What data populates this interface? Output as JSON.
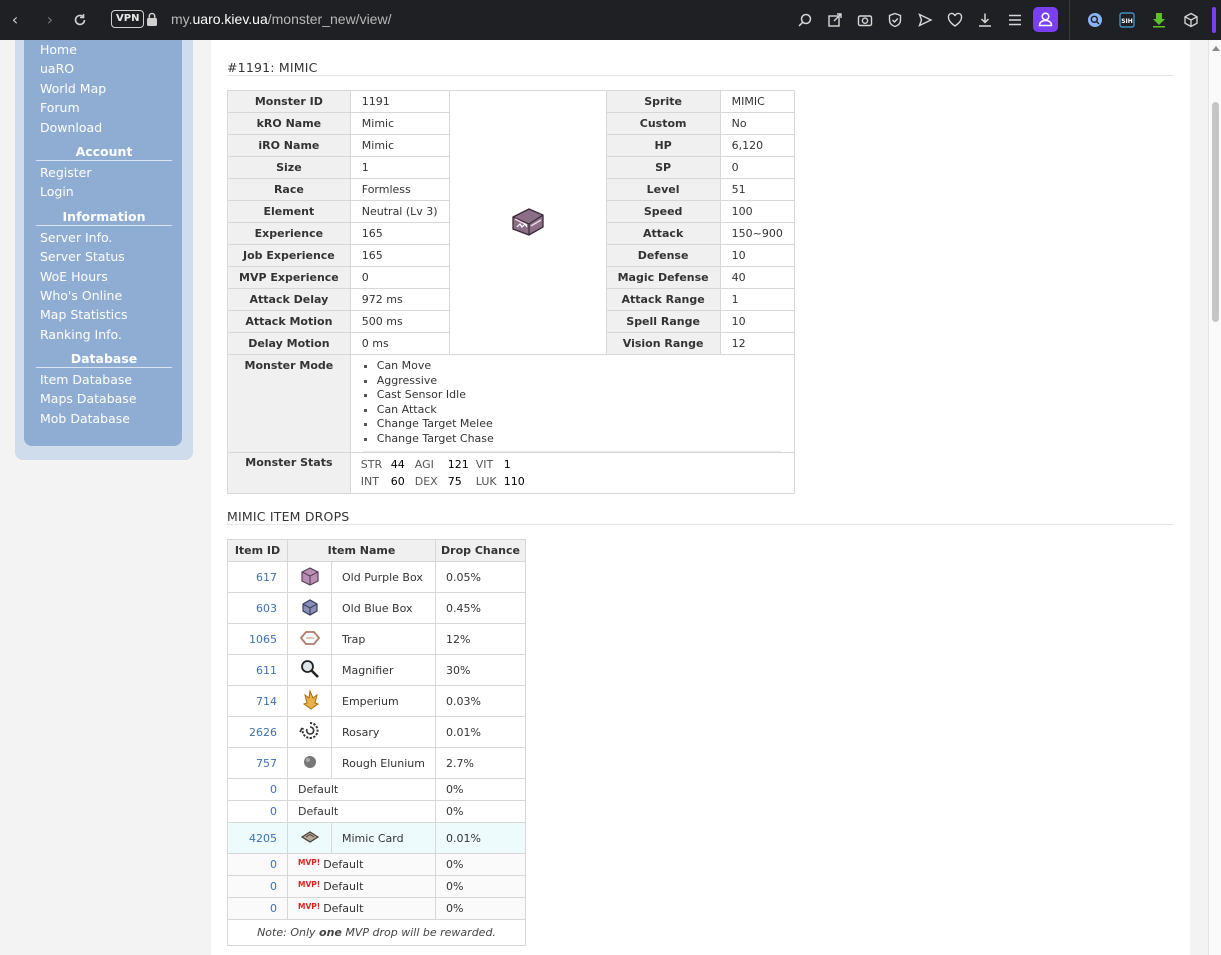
{
  "browser": {
    "url_prefix": "my.",
    "url_domain": "uaro.kiev.ua",
    "url_path": "/monster_new/view/",
    "vpn_label": "VPN",
    "extension_label": "SIH"
  },
  "sidebar": {
    "main": [
      "Home",
      "uaRO",
      "World Map",
      "Forum",
      "Download"
    ],
    "account_heading": "Account",
    "account": [
      "Register",
      "Login"
    ],
    "information_heading": "Information",
    "information": [
      "Server Info.",
      "Server Status",
      "WoE Hours",
      "Who's Online",
      "Map Statistics",
      "Ranking Info."
    ],
    "database_heading": "Database",
    "database": [
      "Item Database",
      "Maps Database",
      "Mob Database"
    ]
  },
  "monster": {
    "title": "#1191: MIMIC",
    "left_rows": [
      {
        "k": "Monster ID",
        "v": "1191"
      },
      {
        "k": "kRO Name",
        "v": "Mimic"
      },
      {
        "k": "iRO Name",
        "v": "Mimic"
      },
      {
        "k": "Size",
        "v": "1"
      },
      {
        "k": "Race",
        "v": "Formless"
      },
      {
        "k": "Element",
        "v": "Neutral (Lv 3)"
      },
      {
        "k": "Experience",
        "v": "165"
      },
      {
        "k": "Job Experience",
        "v": "165"
      },
      {
        "k": "MVP Experience",
        "v": "0"
      },
      {
        "k": "Attack Delay",
        "v": "972 ms"
      },
      {
        "k": "Attack Motion",
        "v": "500 ms"
      },
      {
        "k": "Delay Motion",
        "v": "0 ms"
      }
    ],
    "right_rows": [
      {
        "k": "Sprite",
        "v": "MIMIC"
      },
      {
        "k": "Custom",
        "v": "No"
      },
      {
        "k": "HP",
        "v": "6,120"
      },
      {
        "k": "SP",
        "v": "0"
      },
      {
        "k": "Level",
        "v": "51"
      },
      {
        "k": "Speed",
        "v": "100"
      },
      {
        "k": "Attack",
        "v": "150~900"
      },
      {
        "k": "Defense",
        "v": "10"
      },
      {
        "k": "Magic Defense",
        "v": "40"
      },
      {
        "k": "Attack Range",
        "v": "1"
      },
      {
        "k": "Spell Range",
        "v": "10"
      },
      {
        "k": "Vision Range",
        "v": "12"
      }
    ],
    "mode_label": "Monster Mode",
    "modes": [
      "Can Move",
      "Aggressive",
      "Cast Sensor Idle",
      "Can Attack",
      "Change Target Melee",
      "Change Target Chase"
    ],
    "stats_label": "Monster Stats",
    "stats_row1": [
      {
        "k": "STR",
        "v": "44"
      },
      {
        "k": "AGI",
        "v": "121"
      },
      {
        "k": "VIT",
        "v": "1"
      }
    ],
    "stats_row2": [
      {
        "k": "INT",
        "v": "60"
      },
      {
        "k": "DEX",
        "v": "75"
      },
      {
        "k": "LUK",
        "v": "110"
      }
    ]
  },
  "drops": {
    "title": "MIMIC ITEM DROPS",
    "headers": {
      "id": "Item ID",
      "name": "Item Name",
      "chance": "Drop Chance"
    },
    "items": [
      {
        "id": "617",
        "name": "Old Purple Box",
        "chance": "0.05%",
        "icon": "purple-box-icon"
      },
      {
        "id": "603",
        "name": "Old Blue Box",
        "chance": "0.45%",
        "icon": "blue-box-icon"
      },
      {
        "id": "1065",
        "name": "Trap",
        "chance": "12%",
        "icon": "trap-icon"
      },
      {
        "id": "611",
        "name": "Magnifier",
        "chance": "30%",
        "icon": "magnifier-icon"
      },
      {
        "id": "714",
        "name": "Emperium",
        "chance": "0.03%",
        "icon": "emperium-icon"
      },
      {
        "id": "2626",
        "name": "Rosary",
        "chance": "0.01%",
        "icon": "rosary-icon"
      },
      {
        "id": "757",
        "name": "Rough Elunium",
        "chance": "2.7%",
        "icon": "elunium-icon"
      }
    ],
    "defaults": [
      {
        "id": "0",
        "name": "Default",
        "chance": "0%"
      },
      {
        "id": "0",
        "name": "Default",
        "chance": "0%"
      }
    ],
    "card": {
      "id": "4205",
      "name": "Mimic Card",
      "chance": "0.01%",
      "icon": "card-icon"
    },
    "mvp_tag": "MVP!",
    "mvp": [
      {
        "id": "0",
        "name": "Default",
        "chance": "0%"
      },
      {
        "id": "0",
        "name": "Default",
        "chance": "0%"
      },
      {
        "id": "0",
        "name": "Default",
        "chance": "0%"
      }
    ],
    "note_pre": "Note: Only ",
    "note_bold": "one",
    "note_post": " MVP drop will be rewarded."
  }
}
